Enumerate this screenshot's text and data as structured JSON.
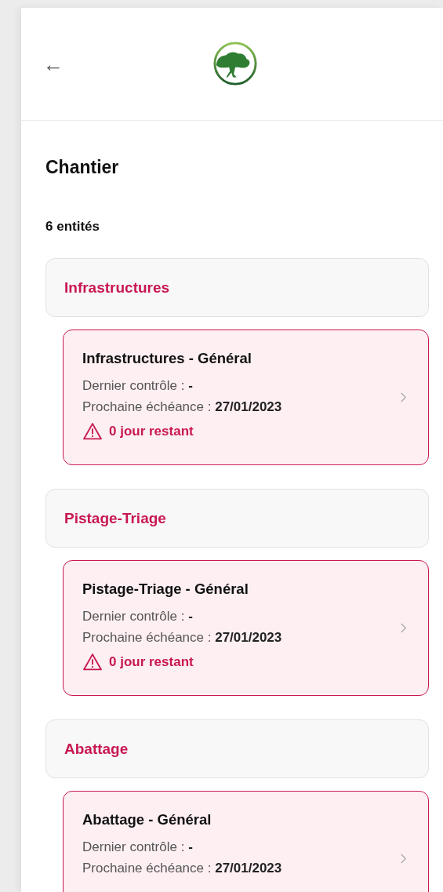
{
  "header": {
    "back": "←"
  },
  "title": "Chantier",
  "count": "6 entités",
  "groups": [
    {
      "name": "Infrastructures",
      "items": [
        {
          "title": "Infrastructures - Général",
          "last_label": "Dernier contrôle :",
          "last_value": "-",
          "next_label": "Prochaine échéance :",
          "next_value": "27/01/2023",
          "warning": "0 jour restant"
        }
      ]
    },
    {
      "name": "Pistage-Triage",
      "items": [
        {
          "title": "Pistage-Triage - Général",
          "last_label": "Dernier contrôle :",
          "last_value": "-",
          "next_label": "Prochaine échéance :",
          "next_value": "27/01/2023",
          "warning": "0 jour restant"
        }
      ]
    },
    {
      "name": "Abattage",
      "items": [
        {
          "title": "Abattage - Général",
          "last_label": "Dernier contrôle :",
          "last_value": "-",
          "next_label": "Prochaine échéance :",
          "next_value": "27/01/2023"
        }
      ]
    }
  ]
}
